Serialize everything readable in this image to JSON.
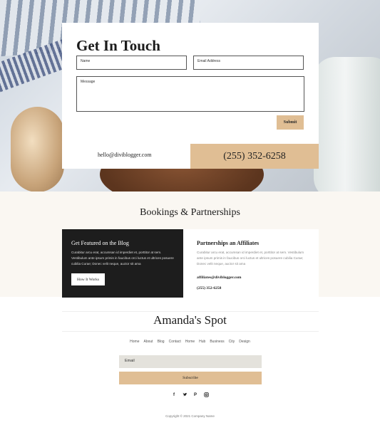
{
  "contact": {
    "title": "Get In Touch",
    "name_placeholder": "Name",
    "email_placeholder": "Email Address",
    "message_placeholder": "Message",
    "submit_label": "Submit",
    "email": "hello@diviblogger.com",
    "phone": "(255) 352-6258"
  },
  "bookings": {
    "title": "Bookings & Partnerships",
    "blog_card": {
      "title": "Get Featured on the Blog",
      "body": "Curabitur arcu erat, accumsan id imperdiet et, porttitor at sem. Vestibulum ante ipsum primis in faucibus orci luctus et ultrices posuere cubilia Curae; Donec velit neque, auctor sit ama",
      "button_label": "How It Works"
    },
    "affiliate_card": {
      "title": "Partnerships an Affiliates",
      "body": "Curabitur arcu erat, accumsan id imperdiet et, porttitor at sem. Vestibulum ante ipsum primis in faucibus orci luctus et ultrices posuere cubilia Curae; Donec velit neque, auctor sit ama",
      "email": "affiliates@diviblogger.com",
      "phone": "(255) 352-6258"
    }
  },
  "footer": {
    "brand": "Amanda's Spot",
    "nav": [
      "Home",
      "About",
      "Blog",
      "Contact",
      "Home",
      "Hub",
      "Business",
      "City",
      "Design"
    ],
    "newsletter_placeholder": "Email",
    "subscribe_label": "Subscribe",
    "social_icons": [
      "facebook-icon",
      "twitter-icon",
      "pinterest-icon",
      "instagram-icon"
    ],
    "social_glyphs": [
      "f",
      "▾",
      "P",
      "◎"
    ],
    "copyright": "Copyright © 2021 Company Name"
  },
  "colors": {
    "accent": "#e0be94",
    "dark": "#1d1d1d",
    "section_bg": "#faf7f2"
  }
}
